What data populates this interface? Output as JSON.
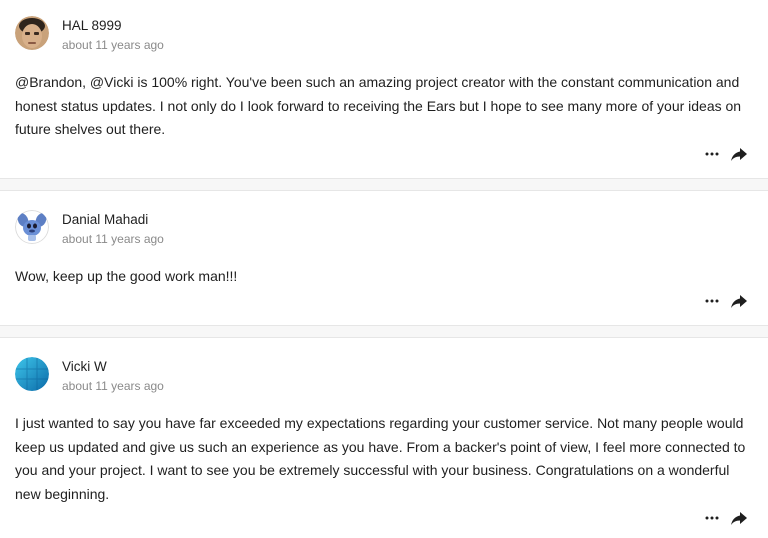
{
  "comments": [
    {
      "author": "HAL 8999",
      "time": "about 11 years ago",
      "text": "@Brandon, @Vicki is 100% right. You've been such an amazing project creator with the constant communication and honest status updates. I not only do I look forward to receiving the Ears but I hope to see many more of your ideas on future shelves out there.",
      "avatar": "face-photo-avatar"
    },
    {
      "author": "Danial Mahadi",
      "time": "about 11 years ago",
      "text": "Wow, keep up the good work man!!!",
      "avatar": "cartoon-character-avatar"
    },
    {
      "author": "Vicki W",
      "time": "about 11 years ago",
      "text": "I just wanted to say you have far exceeded my expectations regarding your customer service. Not many people would keep us updated and give us such an experience as you have. From a backer's point of view, I feel more connected to you and your project. I want to see you be extremely successful with your business. Congratulations on a wonderful new beginning.",
      "avatar": "blue-tile-avatar"
    }
  ],
  "icons": {
    "more": "more-horizontal-icon",
    "share": "share-arrow-icon"
  },
  "colors": {
    "text": "#1f1f1f",
    "muted": "#8a8a8a",
    "divider": "#f7f7f7"
  }
}
